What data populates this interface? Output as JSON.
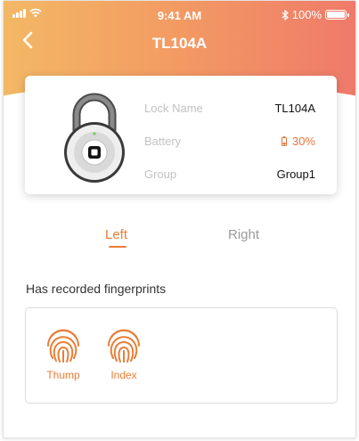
{
  "status_bar": {
    "time": "9:41 AM",
    "battery": "100%"
  },
  "nav": {
    "title": "TL104A"
  },
  "lock_card": {
    "rows": [
      {
        "label": "Lock Name",
        "value": "TL104A"
      },
      {
        "label": "Battery",
        "value": "30%"
      },
      {
        "label": "Group",
        "value": "Group1"
      }
    ]
  },
  "tabs": [
    {
      "label": "Left",
      "active": true
    },
    {
      "label": "Right",
      "active": false
    }
  ],
  "fingerprints": {
    "title": "Has recorded fingerprints",
    "items": [
      {
        "label": "Thump",
        "icon": "fingerprint-icon"
      },
      {
        "label": "Index",
        "icon": "fingerprint-icon"
      }
    ]
  },
  "colors": {
    "accent": "#e87e37",
    "header_start": "#f3b865",
    "header_end": "#ef7a6a"
  }
}
